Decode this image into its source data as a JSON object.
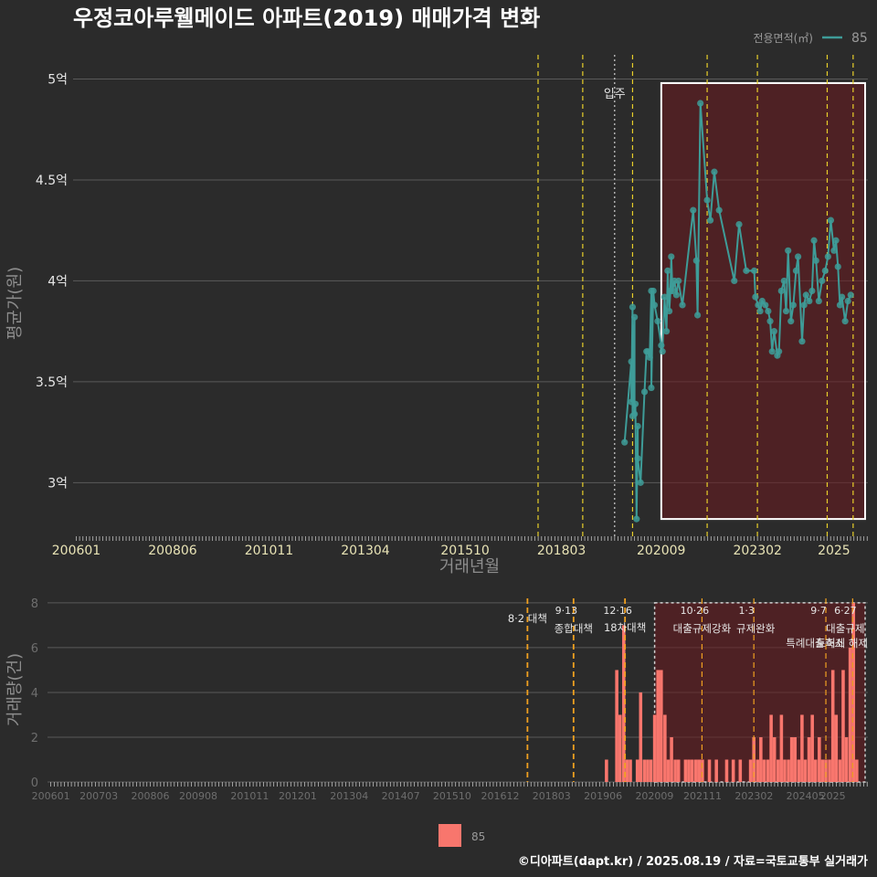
{
  "title": "우정코아루웰메이드 아파트(2019) 매매가격 변화",
  "footer": "©디아파트(dapt.kr) / 2025.08.19 / 자료=국토교통부 실거래가",
  "colors": {
    "background": "#2b2b2b",
    "price_line": "#3e9c98",
    "volume_bar": "#f8766d",
    "policy_line": "#e8cf2a",
    "policy_line_bottom": "#f0a020",
    "highlight_fill": "#6b1a1f",
    "grid": "#5a5a5a"
  },
  "chart_data": [
    {
      "type": "line",
      "title": "우정코아루웰메이드 아파트(2019) 매매가격 변화",
      "xlabel": "거래년월",
      "ylabel": "평균가(원)",
      "legend_title": "전용면적(㎡)",
      "legend_position": "top-right",
      "x_ticks": [
        "200601",
        "200806",
        "201011",
        "201304",
        "201510",
        "201803",
        "202009",
        "202302",
        "2025"
      ],
      "y_ticks": [
        3.0,
        3.5,
        4.0,
        4.5,
        5.0
      ],
      "y_tick_labels": [
        "3억",
        "3.5억",
        "4억",
        "4.5억",
        "5억"
      ],
      "ylim": [
        2.73,
        5.12
      ],
      "xlim": [
        2005.92,
        2025.85
      ],
      "annotations": [
        {
          "label": "입주",
          "x": 2019.5
        }
      ],
      "vlines_policy": [
        2017.58,
        2018.7,
        2019.95,
        2021.82,
        2023.08,
        2024.83,
        2025.48
      ],
      "vline_move_in": 2019.5,
      "highlight": {
        "x": [
          2020.67,
          2025.85
        ],
        "y": [
          2.82,
          4.98
        ]
      },
      "series": [
        {
          "name": "85",
          "x": [
            2019.75,
            2019.92,
            2019.92,
            2019.95,
            2019.95,
            2020.0,
            2020.0,
            2020.02,
            2020.05,
            2020.08,
            2020.08,
            2020.15,
            2020.25,
            2020.3,
            2020.33,
            2020.38,
            2020.42,
            2020.42,
            2020.47,
            2020.5,
            2020.58,
            2020.67,
            2020.7,
            2020.75,
            2020.8,
            2020.83,
            2020.87,
            2020.9,
            2020.92,
            2020.95,
            2021.0,
            2021.05,
            2021.1,
            2021.2,
            2021.47,
            2021.55,
            2021.58,
            2021.65,
            2021.82,
            2021.9,
            2022.0,
            2022.12,
            2022.5,
            2022.62,
            2022.8,
            2023.0,
            2023.03,
            2023.1,
            2023.15,
            2023.2,
            2023.28,
            2023.35,
            2023.4,
            2023.45,
            2023.5,
            2023.58,
            2023.62,
            2023.68,
            2023.75,
            2023.8,
            2023.85,
            2023.92,
            2023.98,
            2024.05,
            2024.1,
            2024.2,
            2024.25,
            2024.3,
            2024.38,
            2024.45,
            2024.5,
            2024.55,
            2024.62,
            2024.7,
            2024.78,
            2024.85,
            2024.92,
            2025.0,
            2025.05,
            2025.1,
            2025.15,
            2025.2,
            2025.28,
            2025.35,
            2025.42
          ],
          "values": [
            3.2,
            3.6,
            3.4,
            3.87,
            3.33,
            3.82,
            3.34,
            3.39,
            2.82,
            3.28,
            3.12,
            3.0,
            3.45,
            3.65,
            3.65,
            3.62,
            3.95,
            3.47,
            3.95,
            3.88,
            3.8,
            3.68,
            3.65,
            3.92,
            3.75,
            4.05,
            3.85,
            3.95,
            4.12,
            3.95,
            4.0,
            3.93,
            4.0,
            3.88,
            4.35,
            4.1,
            3.83,
            4.88,
            4.4,
            4.3,
            4.54,
            4.35,
            4.0,
            4.28,
            4.05,
            4.05,
            3.92,
            3.88,
            3.85,
            3.9,
            3.88,
            3.85,
            3.8,
            3.65,
            3.75,
            3.63,
            3.65,
            3.95,
            4.0,
            3.85,
            4.15,
            3.8,
            3.88,
            4.05,
            4.12,
            3.7,
            3.88,
            3.93,
            3.9,
            3.95,
            4.2,
            4.1,
            3.9,
            4.0,
            4.05,
            4.12,
            4.3,
            4.15,
            4.2,
            4.07,
            3.88,
            3.92,
            3.8,
            3.9,
            3.93
          ]
        }
      ]
    },
    {
      "type": "bar",
      "ylabel": "거래량(건)",
      "legend_entry": "85",
      "legend_position": "bottom",
      "x_ticks": [
        "200601",
        "200703",
        "200806",
        "200908",
        "201011",
        "201201",
        "201304",
        "201407",
        "201510",
        "201612",
        "201803",
        "201906",
        "202009",
        "202111",
        "202302",
        "202405",
        "2025"
      ],
      "y_ticks": [
        0,
        2,
        4,
        6,
        8
      ],
      "ylim": [
        0,
        8.2
      ],
      "xlim": [
        2005.92,
        2025.85
      ],
      "policy_events": [
        {
          "x": 2017.58,
          "date": "",
          "label": "8·2 대책"
        },
        {
          "x": 2018.7,
          "date": "9·13",
          "label": "종합대책"
        },
        {
          "x": 2019.95,
          "date": "12·16",
          "label": "18차대책"
        },
        {
          "x": 2021.82,
          "date": "10·26",
          "label": "대출규제강화"
        },
        {
          "x": 2023.08,
          "date": "1·3",
          "label": "규제완화"
        },
        {
          "x": 2024.83,
          "date": "9·7",
          "label": "특례대출축소"
        },
        {
          "x": 2025.48,
          "date": "6·27",
          "label": "대출규제"
        }
      ],
      "extra_annotation": "토허제 해제",
      "highlight": {
        "x": [
          2020.67,
          2025.85
        ],
        "y": [
          0,
          8
        ]
      },
      "series": [
        {
          "name": "85",
          "x": [
            2019.5,
            2019.75,
            2019.83,
            2019.92,
            2020.0,
            2020.08,
            2020.25,
            2020.33,
            2020.42,
            2020.5,
            2020.58,
            2020.67,
            2020.75,
            2020.83,
            2020.92,
            2021.0,
            2021.08,
            2021.17,
            2021.25,
            2021.42,
            2021.5,
            2021.58,
            2021.67,
            2021.75,
            2021.83,
            2022.0,
            2022.17,
            2022.42,
            2022.58,
            2022.75,
            2023.0,
            2023.08,
            2023.17,
            2023.25,
            2023.33,
            2023.42,
            2023.5,
            2023.58,
            2023.67,
            2023.75,
            2023.83,
            2023.92,
            2024.0,
            2024.08,
            2024.17,
            2024.25,
            2024.33,
            2024.42,
            2024.5,
            2024.58,
            2024.67,
            2024.75,
            2024.83,
            2024.92,
            2025.0,
            2025.08,
            2025.17,
            2025.25,
            2025.33,
            2025.42,
            2025.5,
            2025.58
          ],
          "values": [
            1,
            5,
            3,
            7,
            1,
            1,
            1,
            4,
            1,
            1,
            1,
            3,
            5,
            5,
            3,
            1,
            2,
            1,
            1,
            1,
            1,
            1,
            1,
            1,
            1,
            1,
            1,
            1,
            1,
            1,
            1,
            2,
            1,
            2,
            1,
            1,
            3,
            2,
            1,
            3,
            1,
            1,
            2,
            2,
            1,
            3,
            1,
            2,
            3,
            1,
            2,
            1,
            1,
            1,
            5,
            3,
            1,
            5,
            2,
            6,
            8,
            1
          ]
        }
      ]
    }
  ]
}
